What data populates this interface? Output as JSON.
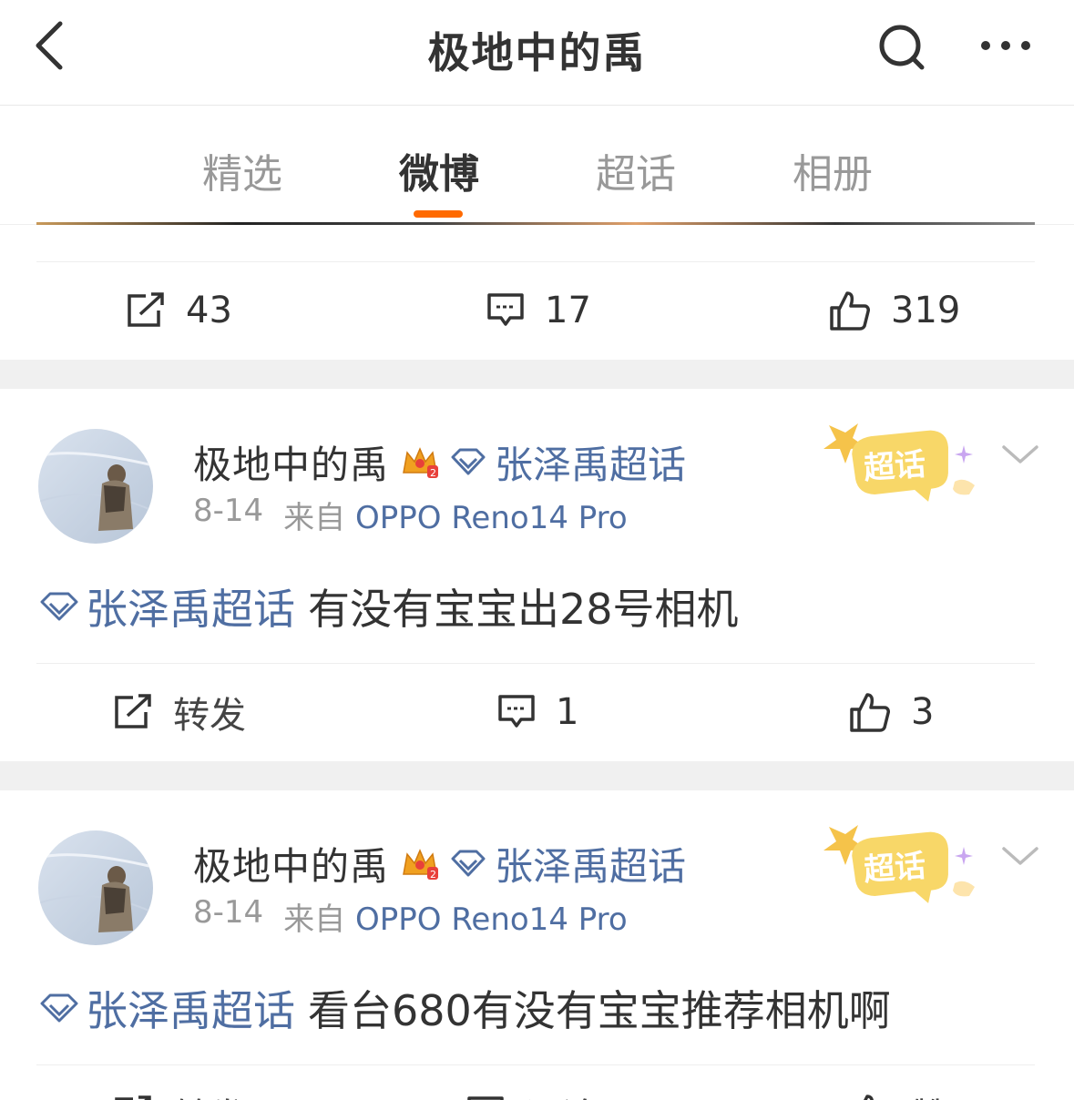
{
  "header": {
    "title": "极地中的禹",
    "back_icon": "chevron-left-icon",
    "search_icon": "search-icon",
    "more_icon": "more-dots-icon"
  },
  "tabs": [
    {
      "label": "精选",
      "active": false
    },
    {
      "label": "微博",
      "active": true
    },
    {
      "label": "超话",
      "active": false
    },
    {
      "label": "相册",
      "active": false
    }
  ],
  "accent_color": "#ff6a00",
  "link_color": "#4f6ea2",
  "top_post_actions": {
    "repost": "43",
    "comment": "17",
    "like": "319"
  },
  "posts": [
    {
      "author": "极地中的禹",
      "topic": "张泽禹超话",
      "date": "8-14",
      "source_prefix": "来自",
      "source": "OPPO Reno14 Pro",
      "badge": "超话",
      "topic_inline": "张泽禹超话",
      "text": "有没有宝宝出28号相机",
      "actions": {
        "repost": "转发",
        "comment": "1",
        "like": "3"
      }
    },
    {
      "author": "极地中的禹",
      "topic": "张泽禹超话",
      "date": "8-14",
      "source_prefix": "来自",
      "source": "OPPO Reno14 Pro",
      "badge": "超话",
      "topic_inline": "张泽禹超话",
      "text": "看台680有没有宝宝推荐相机啊",
      "actions": {
        "repost": "转发",
        "comment": "评论",
        "like": "赞"
      }
    }
  ]
}
